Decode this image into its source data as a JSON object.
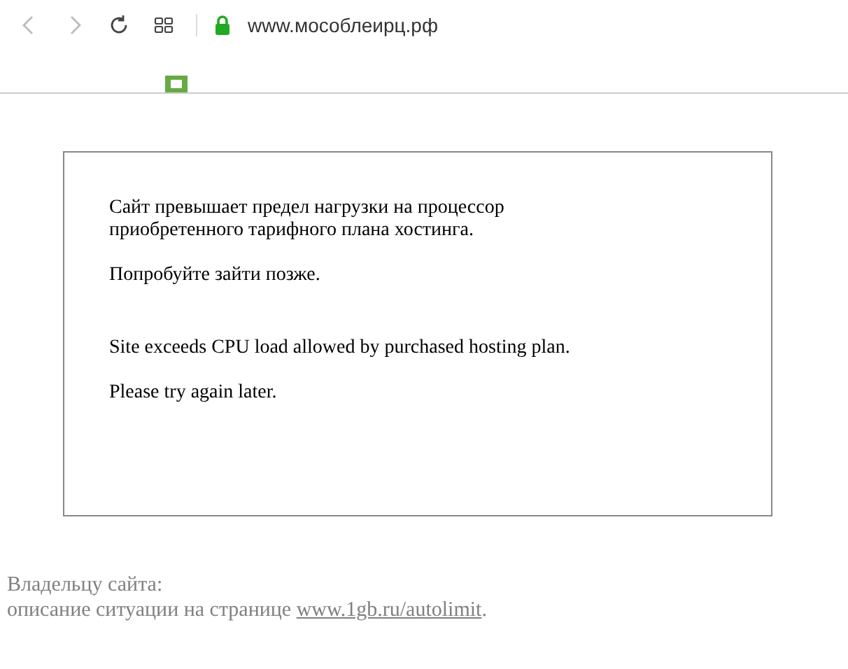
{
  "browser": {
    "url": "www.мособлеирц.рф",
    "secure": true
  },
  "message": {
    "paragraphs": [
      "Сайт превышает предел нагрузки на процессор приобретенного тарифного плана хостинга.",
      "Попробуйте зайти позже.",
      "Site exceeds CPU load allowed by purchased hosting plan.",
      "Please try again later."
    ]
  },
  "footer": {
    "heading": "Владельцу сайта:",
    "text": "описание ситуации на странице ",
    "link": "www.1gb.ru/autolimit",
    "after": "."
  }
}
